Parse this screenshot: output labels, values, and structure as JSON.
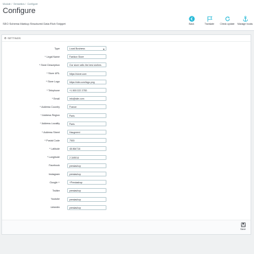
{
  "breadcrumb": [
    "Module",
    "Semantics",
    "Configure"
  ],
  "header": {
    "title": "Configure",
    "subtitle": "SEO Schema Markup Structured Data Rich Snippet"
  },
  "toolbar": [
    {
      "label": "Back",
      "icon": "back-circle-icon"
    },
    {
      "label": "Translate",
      "icon": "flag-icon"
    },
    {
      "label": "Check update",
      "icon": "refresh-icon"
    },
    {
      "label": "Manage hooks",
      "icon": "anchor-icon"
    }
  ],
  "panel": {
    "heading": "SETTINGS",
    "save_label": "Save"
  },
  "form": [
    {
      "label": "Type",
      "value": "Local Business",
      "kind": "select"
    },
    {
      "label": "* Legal Name",
      "value": "Fashion Store"
    },
    {
      "label": "* Store Description",
      "value": "Our store sells the best clothes"
    },
    {
      "label": "* Store URL",
      "value": "https://store.com"
    },
    {
      "label": "* Store Logo",
      "value": "https://site.com/logo.png"
    },
    {
      "label": "* Telephone",
      "value": "+1 800 222 2783"
    },
    {
      "label": "* Email",
      "value": "info@site.com"
    },
    {
      "label": "* Address Country",
      "value": "France"
    },
    {
      "label": "* Address Region",
      "value": "Paris"
    },
    {
      "label": "* Address Locality",
      "value": "Paris"
    },
    {
      "label": "* Address Street",
      "value": "Haugmeni"
    },
    {
      "label": "* Postal Code",
      "value": "7500"
    },
    {
      "label": "* Latitude",
      "value": "48.864716"
    },
    {
      "label": "* Longitude",
      "value": "2.349014"
    },
    {
      "label": "Facebook",
      "value": "prestashop"
    },
    {
      "label": "Instagram",
      "value": "prestashop"
    },
    {
      "label": "Google +",
      "value": "+Prestashop"
    },
    {
      "label": "Twitter",
      "value": "prestashop"
    },
    {
      "label": "Youtube",
      "value": "prestashop"
    },
    {
      "label": "Linkedin",
      "value": "prestashop"
    }
  ],
  "colors": {
    "accent": "#25b9d7",
    "background": "#eff1f2",
    "border": "#bbcdd2"
  }
}
